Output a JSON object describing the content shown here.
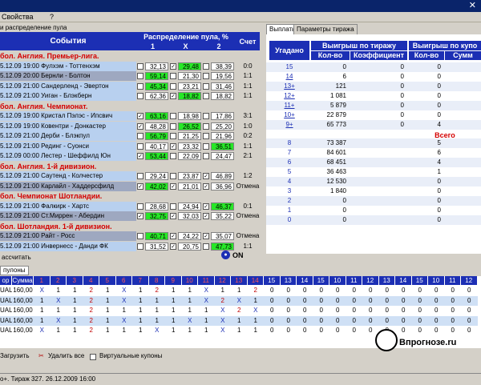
{
  "menu": {
    "items": [
      "Свойства",
      "?"
    ]
  },
  "left": {
    "title": "и распределение пула",
    "events_header": "События",
    "dist_header": "Распределение пула, %",
    "col1": "1",
    "colx": "X",
    "col2": "2",
    "score_header": "Счет",
    "rows": [
      {
        "t": "league",
        "text": "бол. Англия. Премьер-лига."
      },
      {
        "t": "match",
        "s": "alt",
        "text": "5.12.09 19:00 Фулхэм - Тоттенхэм",
        "c1": false,
        "v1": "32,13",
        "g1": false,
        "cx": true,
        "vx": "29,48",
        "gx": true,
        "c2": false,
        "v2": "38,39",
        "g2": false,
        "score": "0:0"
      },
      {
        "t": "match",
        "s": "dark",
        "text": "5.12.09 20:00 Бернли - Болтон",
        "c1": false,
        "v1": "59,14",
        "g1": true,
        "cx": false,
        "vx": "21,30",
        "gx": false,
        "c2": false,
        "v2": "19,56",
        "g2": false,
        "score": "1:1"
      },
      {
        "t": "match",
        "s": "alt",
        "text": "5.12.09 21:00 Сандерленд - Эвертон",
        "c1": false,
        "v1": "45,34",
        "g1": true,
        "cx": false,
        "vx": "23,21",
        "gx": false,
        "c2": false,
        "v2": "31,46",
        "g2": false,
        "score": "1:1"
      },
      {
        "t": "match",
        "s": "alt",
        "text": "5.12.09 21:00 Уиган - Блэкберн",
        "c1": false,
        "v1": "62,36",
        "g1": false,
        "cx": true,
        "vx": "18,82",
        "gx": true,
        "c2": false,
        "v2": "18,82",
        "g2": false,
        "score": "1:1"
      },
      {
        "t": "league",
        "text": "бол. Англия. Чемпионат."
      },
      {
        "t": "match",
        "s": "alt",
        "text": "5.12.09 19:00 Кристал Пэлэс - Ипсвич",
        "c1": true,
        "v1": "63,16",
        "g1": true,
        "cx": false,
        "vx": "18,98",
        "gx": false,
        "c2": false,
        "v2": "17,86",
        "g2": false,
        "score": "3:1"
      },
      {
        "t": "match",
        "s": "alt",
        "text": "5.12.09 19:00 Ковентри - Донкастер",
        "c1": true,
        "v1": "48,28",
        "g1": false,
        "cx": false,
        "vx": "26,52",
        "gx": true,
        "c2": false,
        "v2": "25,20",
        "g2": false,
        "score": "1:0"
      },
      {
        "t": "match",
        "s": "alt",
        "text": "5.12.09 21:00 Дерби - Блэкпул",
        "c1": false,
        "v1": "56,79",
        "g1": true,
        "cx": false,
        "vx": "21,25",
        "gx": false,
        "c2": false,
        "v2": "21,96",
        "g2": false,
        "score": "0:2"
      },
      {
        "t": "match",
        "s": "alt",
        "text": "5.12.09 21:00 Рединг - Суонси",
        "c1": false,
        "v1": "40,17",
        "g1": false,
        "cx": true,
        "vx": "23,32",
        "gx": false,
        "c2": false,
        "v2": "36,51",
        "g2": true,
        "score": "1:1"
      },
      {
        "t": "match",
        "s": "alt",
        "text": "5.12.09 00:00 Лестер - Шеффилд Юн",
        "c1": true,
        "v1": "53,44",
        "g1": true,
        "cx": false,
        "vx": "22,09",
        "gx": false,
        "c2": false,
        "v2": "24,47",
        "g2": false,
        "score": "2:1"
      },
      {
        "t": "league",
        "text": "бол. Англия. 1-й дивизион."
      },
      {
        "t": "match",
        "s": "alt",
        "text": "5.12.09 21:00 Саутенд - Колчестер",
        "c1": false,
        "v1": "29,24",
        "g1": false,
        "cx": false,
        "vx": "23,87",
        "gx": false,
        "c2": true,
        "v2": "46,89",
        "g2": false,
        "score": "1:2"
      },
      {
        "t": "match",
        "s": "dark",
        "text": "5.12.09 21:00 Карлайл - Хаддерсфилд",
        "c1": true,
        "v1": "42,02",
        "g1": true,
        "cx": true,
        "vx": "21,01",
        "gx": false,
        "c2": true,
        "v2": "36,96",
        "g2": false,
        "score": "Отмена"
      },
      {
        "t": "league",
        "text": "бол. Чемпионат Шотландии."
      },
      {
        "t": "match",
        "s": "alt",
        "text": "5.12.09 21:00 Фалкирк - Хартс",
        "c1": false,
        "v1": "28,68",
        "g1": false,
        "cx": false,
        "vx": "24,94",
        "gx": false,
        "c2": true,
        "v2": "46,37",
        "g2": true,
        "score": "0:1"
      },
      {
        "t": "match",
        "s": "dark",
        "text": "5.12.09 21:00 Ст.Миррен - Абердин",
        "c1": true,
        "v1": "32,75",
        "g1": true,
        "cx": true,
        "vx": "32,03",
        "gx": false,
        "c2": true,
        "v2": "35,22",
        "g2": false,
        "score": "Отмена"
      },
      {
        "t": "league",
        "text": "бол. Шотландия. 1-й дивизион."
      },
      {
        "t": "match",
        "s": "dark",
        "text": "5.12.09 21:00 Райт - Росс",
        "c1": false,
        "v1": "40,71",
        "g1": true,
        "cx": true,
        "vx": "24,22",
        "gx": false,
        "c2": true,
        "v2": "35,07",
        "g2": false,
        "score": "Отмена"
      },
      {
        "t": "match",
        "s": "alt",
        "text": "5.12.09 21:00 Инвернесс - Данди ФК",
        "c1": false,
        "v1": "31,52",
        "g1": false,
        "cx": true,
        "vx": "20,75",
        "gx": false,
        "c2": false,
        "v2": "47,73",
        "g2": true,
        "score": "1:1"
      }
    ],
    "recalc": "ассчитать",
    "status": "ON"
  },
  "right": {
    "tab1": "Выплаты",
    "tab2": "Параметры тиража",
    "h_guessed": "Угадано",
    "h_win": "Выигрыш по тиражу",
    "h_win2": "Выигрыш по купо",
    "h_count": "Кол-во",
    "h_coef": "Коэффициент",
    "h_count2": "Кол-во",
    "h_sum": "Сумм",
    "rows": [
      {
        "g": "15",
        "c": "0",
        "k": "0",
        "c2": "0"
      },
      {
        "g": "14",
        "c": "6",
        "k": "0",
        "c2": "0"
      },
      {
        "g": "13+",
        "c": "121",
        "k": "0",
        "c2": "0"
      },
      {
        "g": "12+",
        "c": "1 081",
        "k": "0",
        "c2": "0"
      },
      {
        "g": "11+",
        "c": "5 879",
        "k": "0",
        "c2": "0"
      },
      {
        "g": "10+",
        "c": "22 879",
        "k": "0",
        "c2": "0"
      },
      {
        "g": "9+",
        "c": "65 773",
        "k": "0",
        "c2": "4"
      }
    ],
    "total": "Всего",
    "rows2": [
      {
        "g": "8",
        "c": "73 387",
        "c2": "5"
      },
      {
        "g": "7",
        "c": "84 601",
        "c2": "6"
      },
      {
        "g": "6",
        "c": "68 451",
        "c2": "4"
      },
      {
        "g": "5",
        "c": "36 463",
        "c2": "1"
      },
      {
        "g": "4",
        "c": "12 530",
        "c2": "0"
      },
      {
        "g": "3",
        "c": "1 840",
        "c2": "0"
      },
      {
        "g": "2",
        "c": "0",
        "c2": "0"
      },
      {
        "g": "1",
        "c": "0",
        "c2": "0"
      },
      {
        "g": "0",
        "c": "0",
        "c2": "0"
      }
    ]
  },
  "coupons": {
    "tab": "пулоны",
    "h_first": "ор",
    "h_sum": "Сумма",
    "cols": [
      "1",
      "2",
      "3",
      "4",
      "5",
      "6",
      "7",
      "8",
      "9",
      "10",
      "11",
      "12",
      "13",
      "14",
      "15",
      "13",
      "14",
      "15",
      "10",
      "11",
      "12",
      "13",
      "14",
      "15",
      "10",
      "11",
      "12"
    ],
    "rows": [
      {
        "a": "UAL",
        "s": "160,00",
        "v": [
          "X",
          "1",
          "1",
          "2",
          "1",
          "X",
          "1",
          "2",
          "1",
          "1",
          "X",
          "1",
          "1",
          "2",
          "0",
          "0",
          "0",
          "0",
          "0",
          "0",
          "0",
          "0",
          "0",
          "0",
          "0",
          "0",
          "0"
        ]
      },
      {
        "a": "UAL",
        "s": "160,00",
        "v": [
          "1",
          "X",
          "1",
          "2",
          "1",
          "X",
          "1",
          "1",
          "1",
          "1",
          "X",
          "2",
          "X",
          "1",
          "0",
          "0",
          "0",
          "0",
          "0",
          "0",
          "0",
          "0",
          "0",
          "0",
          "0",
          "0",
          "0"
        ]
      },
      {
        "a": "UAL",
        "s": "160,00",
        "v": [
          "1",
          "1",
          "1",
          "2",
          "1",
          "1",
          "1",
          "1",
          "1",
          "1",
          "1",
          "X",
          "2",
          "X",
          "0",
          "0",
          "0",
          "0",
          "0",
          "0",
          "0",
          "0",
          "0",
          "0",
          "0",
          "0",
          "0"
        ]
      },
      {
        "a": "UAL",
        "s": "160,00",
        "v": [
          "1",
          "X",
          "1",
          "2",
          "1",
          "X",
          "1",
          "1",
          "1",
          "X",
          "1",
          "X",
          "1",
          "1",
          "0",
          "0",
          "0",
          "0",
          "0",
          "0",
          "0",
          "0",
          "0",
          "0",
          "0",
          "0",
          "0"
        ]
      },
      {
        "a": "UAL",
        "s": "160,00",
        "v": [
          "X",
          "1",
          "1",
          "2",
          "1",
          "1",
          "1",
          "X",
          "1",
          "1",
          "1",
          "X",
          "1",
          "1",
          "0",
          "0",
          "0",
          "0",
          "0",
          "0",
          "0",
          "0",
          "0",
          "0",
          "0",
          "0",
          "0"
        ]
      }
    ]
  },
  "toolbar": {
    "load": "Загрузить",
    "delete_all": "Удалить все",
    "virtual": "Виртуальные купоны"
  },
  "statusbar": {
    "text": "о+. Тираж 327. 26.12.2009 16:00"
  },
  "brand": {
    "site": "Впрогнозе.ru"
  }
}
